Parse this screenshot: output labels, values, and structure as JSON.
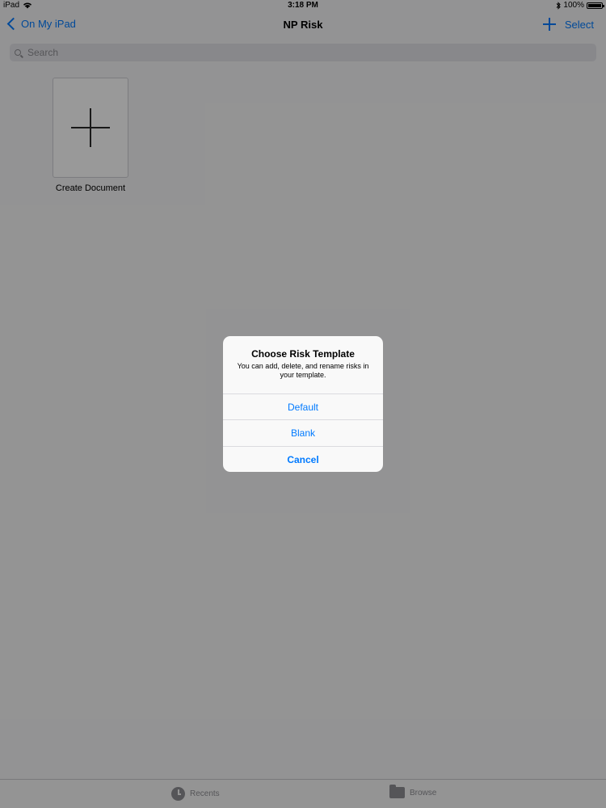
{
  "status_bar": {
    "device": "iPad",
    "time": "3:18 PM",
    "battery_text": "100%",
    "battery_level": 1.0
  },
  "nav": {
    "back_label": "On My iPad",
    "title": "NP Risk",
    "select_label": "Select"
  },
  "search": {
    "placeholder": "Search"
  },
  "create_document": {
    "label": "Create Document"
  },
  "tab_bar": {
    "recents_label": "Recents",
    "browse_label": "Browse"
  },
  "alert": {
    "title": "Choose Risk Template",
    "message": "You can add, delete, and rename risks in your template.",
    "buttons": [
      {
        "label": "Default"
      },
      {
        "label": "Blank"
      },
      {
        "label": "Cancel"
      }
    ]
  },
  "icons": {
    "wifi": "wifi-icon",
    "bluetooth": "bluetooth-icon",
    "battery": "battery-icon",
    "back": "chevron-left-icon",
    "add": "plus-icon",
    "search": "search-icon",
    "create": "plus-icon",
    "recents": "clock-icon",
    "browse": "folder-icon"
  },
  "colors": {
    "accent": "#007aff",
    "background": "#f6f6f7",
    "alert_background": "#f9f9f9",
    "dimmer": "rgba(0,0,0,0.40)"
  }
}
